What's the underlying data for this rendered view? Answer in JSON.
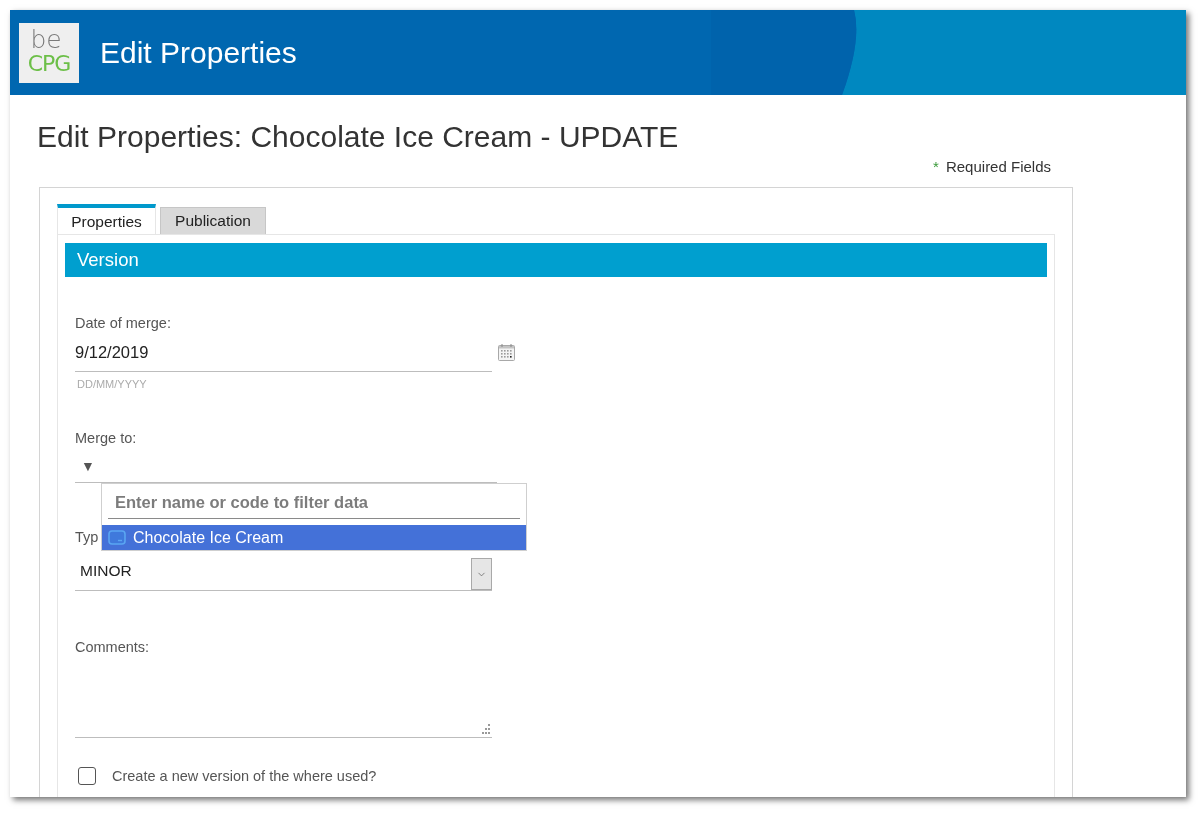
{
  "header": {
    "logo": {
      "top": "be",
      "bottom": "CPG"
    },
    "title": "Edit Properties"
  },
  "page_title": "Edit Properties: Chocolate Ice Cream - UPDATE",
  "required_note": {
    "marker": "*",
    "text": "Required Fields"
  },
  "tabs": [
    {
      "label": "Properties",
      "selected": true
    },
    {
      "label": "Publication",
      "selected": false
    }
  ],
  "section": {
    "title": "Version"
  },
  "fields": [
    {
      "kind": "date",
      "label": "Date of merge:",
      "value": "9/12/2019",
      "hint": "DD/MM/YYYY"
    },
    {
      "kind": "picker",
      "label": "Merge to:",
      "toggle": "▼",
      "dropdown": {
        "search_placeholder": "Enter name or code to filter data",
        "options": [
          {
            "label": "Chocolate Ice Cream",
            "selected": true
          }
        ]
      }
    },
    {
      "kind": "select",
      "label": "Typ",
      "value": "MINOR"
    },
    {
      "kind": "textarea",
      "label": "Comments:"
    },
    {
      "kind": "checkbox",
      "label": "Create a new version of the where used?",
      "checked": false
    }
  ]
}
